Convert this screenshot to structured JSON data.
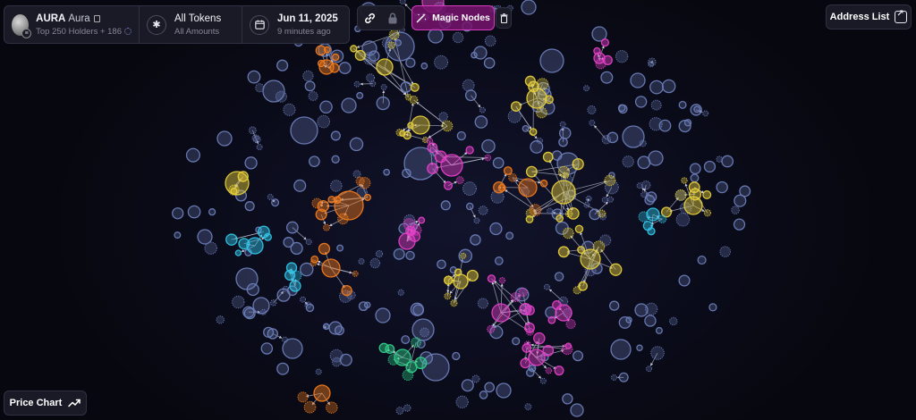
{
  "token": {
    "symbol": "AURA",
    "name": "Aura",
    "holders_text": "Top 250 Holders + 186"
  },
  "filter": {
    "title": "All Tokens",
    "subtitle": "All Amounts"
  },
  "date": {
    "title": "Jun 11, 2025",
    "subtitle": "9 minutes ago"
  },
  "toolbar": {
    "magic_label": "Magic Nodes"
  },
  "buttons": {
    "address_list": "Address List",
    "price_chart": "Price Chart"
  },
  "icons": {
    "token_avatar": "token-avatar-icon",
    "copy": "copy-icon",
    "loading": "spinner-icon",
    "filter": "asterisk-icon",
    "calendar": "calendar-icon",
    "link": "link-icon",
    "lock": "lock-icon",
    "magic": "magic-wand-icon",
    "trash": "trash-icon",
    "expand": "expand-icon",
    "chart": "trend-icon"
  },
  "colors": {
    "background": "#07080f",
    "panel": "#1a1b26",
    "panel_border": "#2e3142",
    "magic_accent": "#d53cc0",
    "node_blue": "#6c7db8",
    "node_yellow": "#e6cf3a",
    "node_magenta": "#e23fc6",
    "node_orange": "#f07a1c",
    "node_cyan": "#2fc4e6",
    "node_green": "#2fd08a"
  }
}
